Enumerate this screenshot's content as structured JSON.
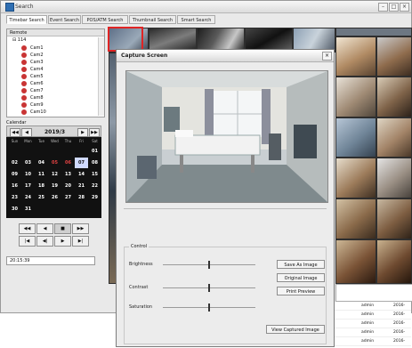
{
  "window": {
    "title": "Search"
  },
  "tabs": [
    {
      "label": "Timebar Search",
      "active": true
    },
    {
      "label": "Event Search",
      "active": false
    },
    {
      "label": "POS/ATM Search",
      "active": false
    },
    {
      "label": "Thumbnail Search",
      "active": false
    },
    {
      "label": "Smart Search",
      "active": false
    }
  ],
  "remote": {
    "header": "Remote",
    "root": "114",
    "cameras": [
      "Cam1",
      "Cam2",
      "Cam3",
      "Cam4",
      "Cam5",
      "Cam6",
      "Cam7",
      "Cam8",
      "Cam9",
      "Cam10"
    ]
  },
  "calendar": {
    "title": "Calendar",
    "month": "2019/3",
    "nav": {
      "prev_year": "◀◀",
      "prev": "◀",
      "next": "▶",
      "next_year": "▶▶"
    },
    "days_header": [
      "Sun",
      "Mon",
      "Tue",
      "Wed",
      "Thu",
      "Fri",
      "Sat"
    ],
    "weeks": [
      [
        "",
        "",
        "",
        "",
        "",
        "",
        "01"
      ],
      [
        "02",
        "03",
        "04",
        "05",
        "06",
        "07",
        "08"
      ],
      [
        "09",
        "10",
        "11",
        "12",
        "13",
        "14",
        "15"
      ],
      [
        "16",
        "17",
        "18",
        "19",
        "20",
        "21",
        "22"
      ],
      [
        "23",
        "24",
        "25",
        "26",
        "27",
        "28",
        "29"
      ],
      [
        "30",
        "31",
        "",
        "",
        "",
        "",
        ""
      ]
    ],
    "selected_day": "07",
    "red_days": [
      "05",
      "06"
    ]
  },
  "playback": {
    "buttons_row1": [
      "◀◀",
      "◀",
      "■",
      "▶▶"
    ],
    "buttons_row2": [
      "|◀",
      "◀|",
      "▶",
      "▶|"
    ],
    "time": "20:15:39"
  },
  "capture_dialog": {
    "title": "Capture Screen",
    "close": "×",
    "control_label": "Control",
    "sliders": [
      {
        "label": "Brightness",
        "value": 0.5
      },
      {
        "label": "Contrast",
        "value": 0.5
      },
      {
        "label": "Saturation",
        "value": 0.5
      }
    ],
    "buttons": {
      "save_as": "Save As Image",
      "original": "Original Image",
      "print_preview": "Print Preview",
      "view_captured": "View Captured Image"
    }
  },
  "event_list": {
    "rows": [
      {
        "user": "admin",
        "date": "2016-"
      },
      {
        "user": "admin",
        "date": "2016-"
      },
      {
        "user": "admin",
        "date": "2016-"
      },
      {
        "user": "admin",
        "date": "2016-"
      },
      {
        "user": "admin",
        "date": "2016-"
      }
    ]
  },
  "colors": {
    "accent_red": "#e02424",
    "calendar_bg": "#111111",
    "dialog_bg": "#ececec"
  }
}
